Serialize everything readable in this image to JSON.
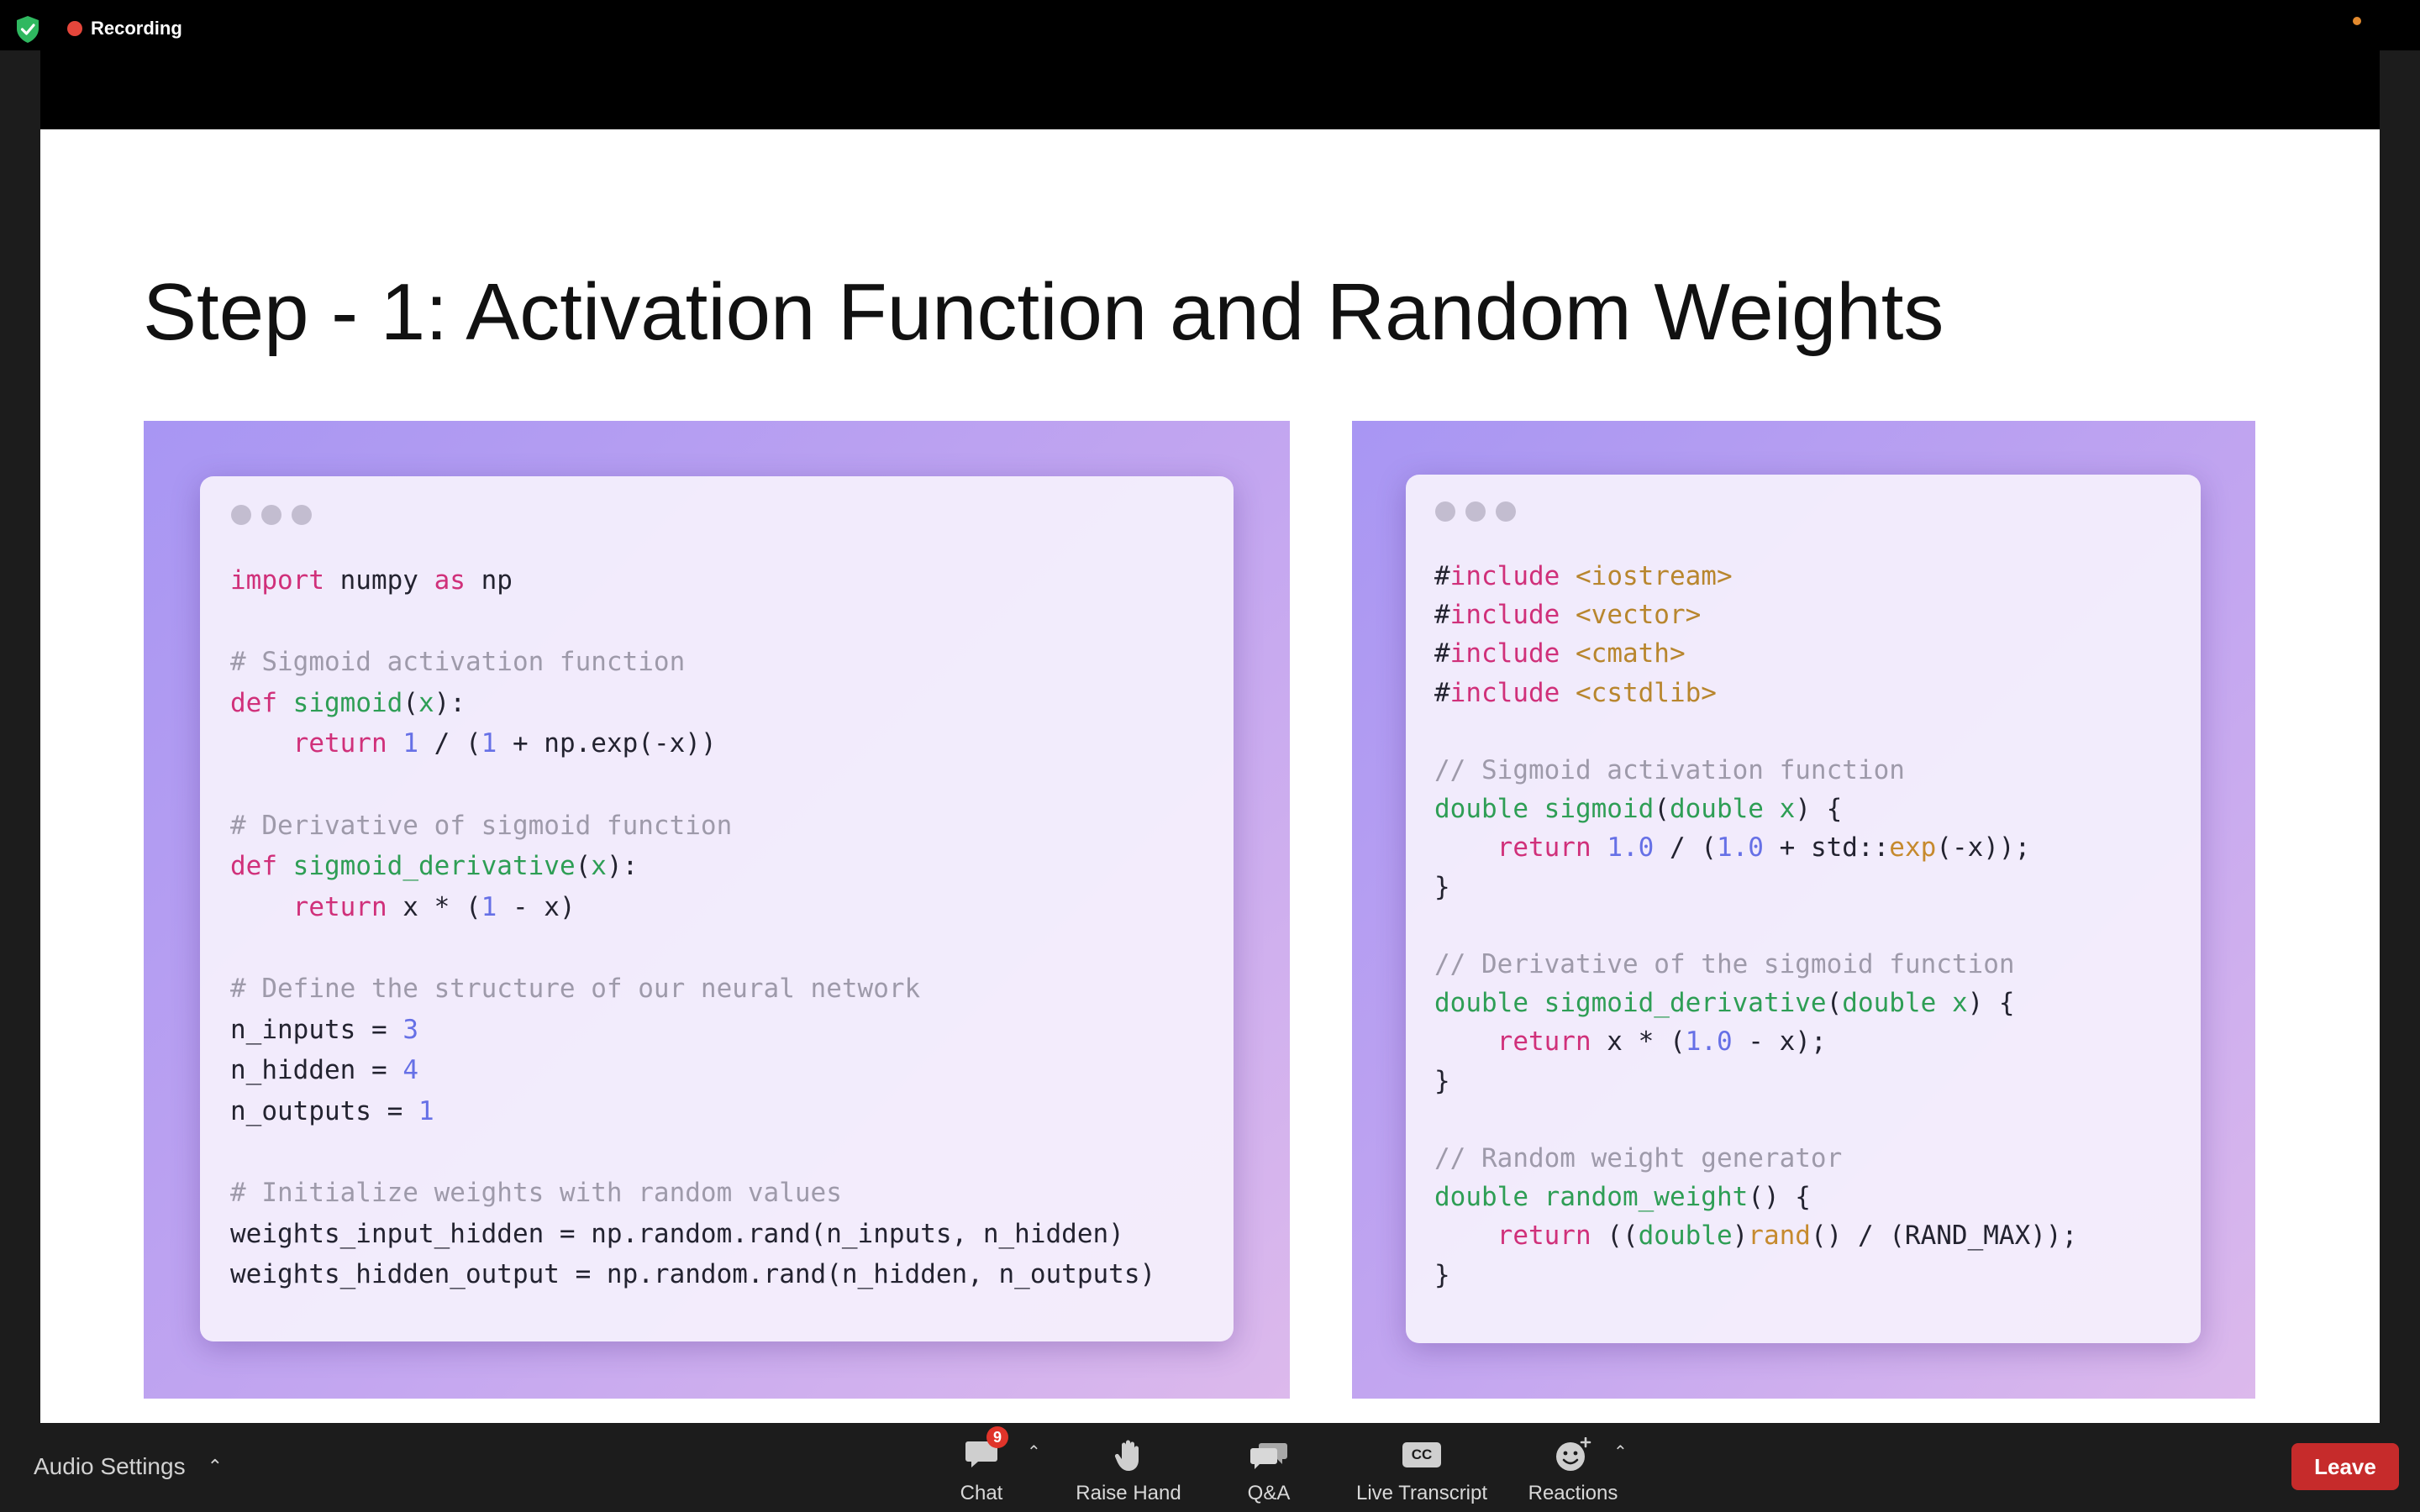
{
  "top_bar": {
    "recording_label": "Recording",
    "colors": {
      "recording": "#e5463b",
      "shield": "#2fb860",
      "dot": "#e38a2e"
    }
  },
  "slide": {
    "title": "Step - 1: Activation Function and Random Weights",
    "python_code": [
      [
        [
          "import",
          "kw"
        ],
        [
          " numpy ",
          ""
        ],
        [
          "as",
          "kw"
        ],
        [
          " np",
          ""
        ]
      ],
      [],
      [
        [
          "# Sigmoid activation function",
          "cm"
        ]
      ],
      [
        [
          "def",
          "kw"
        ],
        [
          " ",
          ""
        ],
        [
          "sigmoid",
          "fn"
        ],
        [
          "(",
          ""
        ],
        [
          "x",
          "fn"
        ],
        [
          "):",
          ""
        ]
      ],
      [
        [
          "    ",
          ""
        ],
        [
          "return",
          "kw"
        ],
        [
          " ",
          ""
        ],
        [
          "1",
          "num"
        ],
        [
          " / (",
          ""
        ],
        [
          "1",
          "num"
        ],
        [
          " + np.exp(-x))",
          ""
        ]
      ],
      [],
      [
        [
          "# Derivative of sigmoid function",
          "cm"
        ]
      ],
      [
        [
          "def",
          "kw"
        ],
        [
          " ",
          ""
        ],
        [
          "sigmoid_derivative",
          "fn"
        ],
        [
          "(",
          ""
        ],
        [
          "x",
          "fn"
        ],
        [
          "):",
          ""
        ]
      ],
      [
        [
          "    ",
          ""
        ],
        [
          "return",
          "kw"
        ],
        [
          " x * (",
          ""
        ],
        [
          "1",
          "num"
        ],
        [
          " - x)",
          ""
        ]
      ],
      [],
      [
        [
          "# Define the structure of our neural network",
          "cm"
        ]
      ],
      [
        [
          "n_inputs = ",
          ""
        ],
        [
          "3",
          "num"
        ]
      ],
      [
        [
          "n_hidden = ",
          ""
        ],
        [
          "4",
          "num"
        ]
      ],
      [
        [
          "n_outputs = ",
          ""
        ],
        [
          "1",
          "num"
        ]
      ],
      [],
      [
        [
          "# Initialize weights with random values",
          "cm"
        ]
      ],
      [
        [
          "weights_input_hidden = np.random.rand(n_inputs, n_hidden)",
          ""
        ]
      ],
      [
        [
          "weights_hidden_output = np.random.rand(n_hidden, n_outputs)",
          ""
        ]
      ]
    ],
    "cpp_code": [
      [
        [
          "#",
          ""
        ],
        [
          "include",
          "kw"
        ],
        [
          " <iostream>",
          "str"
        ]
      ],
      [
        [
          "#",
          ""
        ],
        [
          "include",
          "kw"
        ],
        [
          " <vector>",
          "str"
        ]
      ],
      [
        [
          "#",
          ""
        ],
        [
          "include",
          "kw"
        ],
        [
          " <cmath>",
          "str"
        ]
      ],
      [
        [
          "#",
          ""
        ],
        [
          "include",
          "kw"
        ],
        [
          " <cstdlib>",
          "str"
        ]
      ],
      [],
      [
        [
          "// Sigmoid activation function",
          "cm"
        ]
      ],
      [
        [
          "double",
          "fn"
        ],
        [
          " ",
          ""
        ],
        [
          "sigmoid",
          "fn"
        ],
        [
          "(",
          ""
        ],
        [
          "double",
          "fn"
        ],
        [
          " ",
          ""
        ],
        [
          "x",
          "fn"
        ],
        [
          ") {",
          ""
        ]
      ],
      [
        [
          "    ",
          ""
        ],
        [
          "return",
          "kw"
        ],
        [
          " ",
          ""
        ],
        [
          "1.0",
          "num"
        ],
        [
          " / (",
          ""
        ],
        [
          "1.0",
          "num"
        ],
        [
          " + std::",
          ""
        ],
        [
          "exp",
          "lib"
        ],
        [
          "(-x));",
          ""
        ]
      ],
      [
        [
          "}",
          ""
        ]
      ],
      [],
      [
        [
          "// Derivative of the sigmoid function",
          "cm"
        ]
      ],
      [
        [
          "double",
          "fn"
        ],
        [
          " ",
          ""
        ],
        [
          "sigmoid_derivative",
          "fn"
        ],
        [
          "(",
          ""
        ],
        [
          "double",
          "fn"
        ],
        [
          " ",
          ""
        ],
        [
          "x",
          "fn"
        ],
        [
          ") {",
          ""
        ]
      ],
      [
        [
          "    ",
          ""
        ],
        [
          "return",
          "kw"
        ],
        [
          " x * (",
          ""
        ],
        [
          "1.0",
          "num"
        ],
        [
          " - x);",
          ""
        ]
      ],
      [
        [
          "}",
          ""
        ]
      ],
      [],
      [
        [
          "// Random weight generator",
          "cm"
        ]
      ],
      [
        [
          "double",
          "fn"
        ],
        [
          " ",
          ""
        ],
        [
          "random_weight",
          "fn"
        ],
        [
          "() {",
          ""
        ]
      ],
      [
        [
          "    ",
          ""
        ],
        [
          "return",
          "kw"
        ],
        [
          " ((",
          ""
        ],
        [
          "double",
          "fn"
        ],
        [
          ")",
          ""
        ],
        [
          "rand",
          "lib"
        ],
        [
          "() / (RAND_MAX));",
          ""
        ]
      ],
      [
        [
          "}",
          ""
        ]
      ]
    ]
  },
  "bottom_bar": {
    "audio_settings_label": "Audio Settings",
    "chat_label": "Chat",
    "chat_badge": "9",
    "raise_hand_label": "Raise Hand",
    "qa_label": "Q&A",
    "live_transcript_label": "Live Transcript",
    "live_transcript_icon_text": "CC",
    "reactions_label": "Reactions",
    "leave_label": "Leave"
  }
}
